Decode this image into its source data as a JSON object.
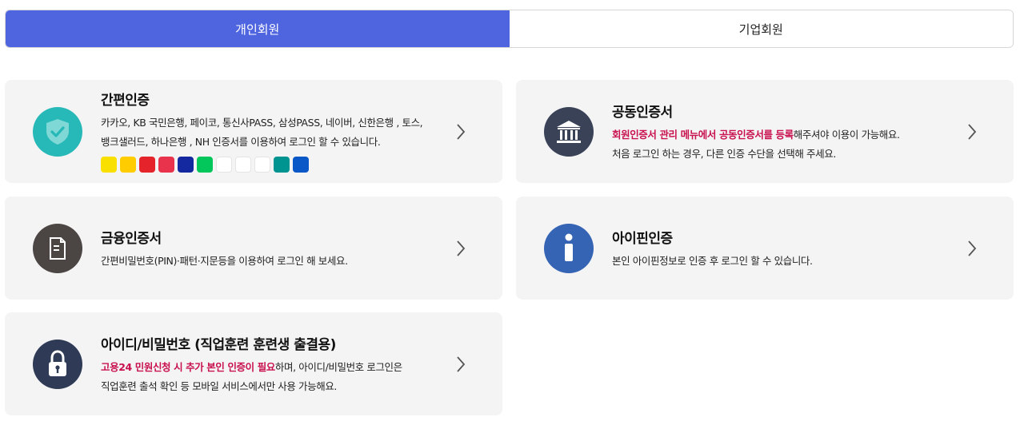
{
  "tabs": [
    {
      "label": "개인회원",
      "active": true
    },
    {
      "label": "기업회원",
      "active": false
    }
  ],
  "cards": {
    "simple": {
      "title": "간편인증",
      "desc_line1": "카카오, KB 국민은행, 페이코, 통신사PASS, 삼성PASS, 네이버, 신한은행 , 토스,",
      "desc_line2": "뱅크샐러드, 하나은행 , NH 인증서를 이용하여 로그인 할 수 있습니다.",
      "icon": "shield-check-icon",
      "icon_color": "#27b8b8",
      "brands": [
        {
          "name": "kakao-talk",
          "label": "TALK",
          "bg": "#f9e000",
          "fg": "#3a1d1d"
        },
        {
          "name": "kb-star",
          "label": "KB",
          "bg": "#ffcc00",
          "fg": "#544"
        },
        {
          "name": "payco",
          "label": "PAYCO",
          "bg": "#e4232b",
          "fg": "#fff"
        },
        {
          "name": "pass",
          "label": "PASS",
          "bg": "#e9324b",
          "fg": "#fff"
        },
        {
          "name": "samsung-pass",
          "label": "Pass",
          "bg": "#1428a0",
          "fg": "#fff"
        },
        {
          "name": "naver",
          "label": "N",
          "bg": "#03c75a",
          "fg": "#fff"
        },
        {
          "name": "shinhan",
          "label": "S",
          "bg": "#ffffff",
          "fg": "#0046ff"
        },
        {
          "name": "toss",
          "label": "t",
          "bg": "#ffffff",
          "fg": "#0064ff"
        },
        {
          "name": "banksalad",
          "label": "b",
          "bg": "#ffffff",
          "fg": "#16a36b"
        },
        {
          "name": "hana",
          "label": "하나",
          "bg": "#009490",
          "fg": "#fff"
        },
        {
          "name": "nh",
          "label": "NH",
          "bg": "#0a58c8",
          "fg": "#fff"
        }
      ]
    },
    "joint": {
      "title": "공동인증서",
      "desc_hl": "회원인증서 관리 메뉴에서 공동인증서를 등록",
      "desc_rest": "해주셔야 이용이 가능해요.",
      "desc_line2": "처음 로그인 하는 경우, 다른 인증 수단을 선택해 주세요.",
      "icon": "bank-building-icon",
      "icon_color": "#3a4257"
    },
    "finance": {
      "title": "금융인증서",
      "desc_line1": "간편비밀번호(PIN)·패턴·지문등을 이용하여 로그인 해 보세요.",
      "icon": "document-icon",
      "icon_color": "#4b4544"
    },
    "ipin": {
      "title": "아이핀인증",
      "desc_line1": "본인 아이핀정보로 인증 후 로그인 할 수 있습니다.",
      "icon": "info-icon",
      "icon_color": "#3564b5"
    },
    "idpw": {
      "title": "아이디/비밀번호 (직업훈련 훈련생 출결용)",
      "desc_hl": "고용24 민원신청 시 추가 본인 인증이 필요",
      "desc_rest": "하며, 아이디/비밀번호 로그인은",
      "desc_line2": "직업훈련 출석 확인 등 모바일 서비스에서만 사용 가능해요.",
      "icon": "lock-icon",
      "icon_color": "#2f3a56"
    }
  },
  "colors": {
    "accent": "#4f65e0",
    "highlight": "#c8114e",
    "card_bg": "#f4f4f5"
  }
}
